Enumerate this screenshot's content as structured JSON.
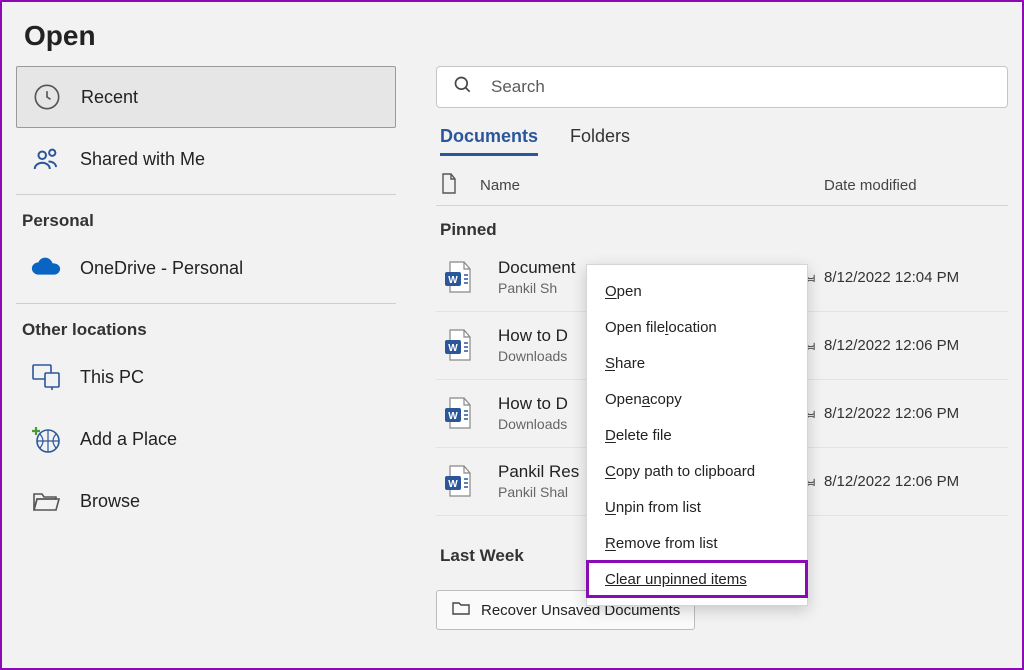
{
  "page_title": "Open",
  "sidebar": {
    "items": [
      {
        "label": "Recent"
      },
      {
        "label": "Shared with Me"
      }
    ],
    "personal_label": "Personal",
    "personal_items": [
      {
        "label": "OneDrive - Personal"
      }
    ],
    "other_label": "Other locations",
    "other_items": [
      {
        "label": "This PC"
      },
      {
        "label": "Add a Place"
      },
      {
        "label": "Browse"
      }
    ]
  },
  "search": {
    "placeholder": "Search"
  },
  "tabs": [
    {
      "label": "Documents"
    },
    {
      "label": "Folders"
    }
  ],
  "columns": {
    "name": "Name",
    "date": "Date modified"
  },
  "groups": {
    "pinned_label": "Pinned",
    "last_week_label": "Last Week"
  },
  "files": [
    {
      "name_full": "Document.docx",
      "name_trunc": "Document d",
      "sub": "Pankil Sh",
      "date": "8/12/2022 12:04 PM"
    },
    {
      "name_full": "How to D",
      "name_trunc": "How to D",
      "sub": "Downloads",
      "date": "8/12/2022 12:06 PM"
    },
    {
      "name_full": "How to D",
      "name_trunc": "How to D",
      "sub": "Downloads",
      "date": "8/12/2022 12:06 PM"
    },
    {
      "name_full": "Pankil Res",
      "name_trunc": "Pankil Res",
      "sub": "Pankil Shal",
      "date": "8/12/2022 12:06 PM"
    }
  ],
  "context_menu": {
    "items": [
      {
        "label_pre": "",
        "key": "O",
        "label_post": "pen"
      },
      {
        "label_pre": "Open file ",
        "key": "l",
        "label_post": "ocation"
      },
      {
        "label_pre": "",
        "key": "S",
        "label_post": "hare"
      },
      {
        "label_pre": "Open ",
        "key": "a",
        "label_post": " copy"
      },
      {
        "label_pre": "",
        "key": "D",
        "label_post": "elete file"
      },
      {
        "label_pre": "",
        "key": "C",
        "label_post": "opy path to clipboard"
      },
      {
        "label_pre": "",
        "key": "U",
        "label_post": "npin from list"
      },
      {
        "label_pre": "",
        "key": "R",
        "label_post": "emove from list"
      },
      {
        "label_pre": "Clear unpinned items",
        "key": "",
        "label_post": ""
      }
    ]
  },
  "recover_label": "Recover Unsaved Documents"
}
